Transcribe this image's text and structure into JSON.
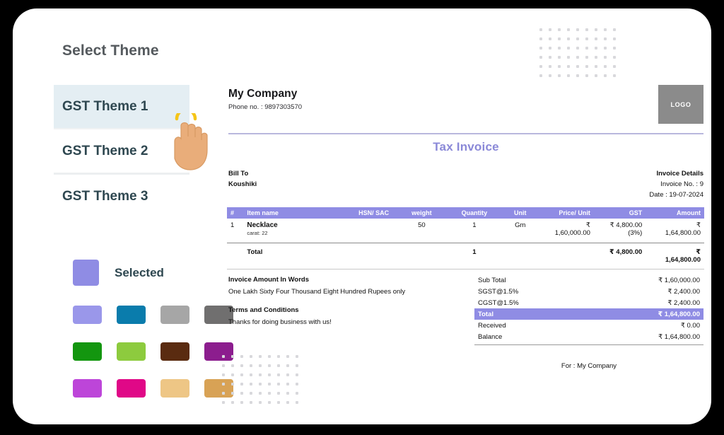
{
  "left_panel": {
    "title": "Select Theme",
    "themes": [
      {
        "label": "GST Theme 1",
        "selected": true
      },
      {
        "label": "GST Theme 2",
        "selected": false
      },
      {
        "label": "GST Theme 3",
        "selected": false
      }
    ],
    "selected_legend": {
      "label": "Selected",
      "color": "#8f8ce4"
    },
    "palette": [
      "#9a97ea",
      "#0a7cac",
      "#a6a6a6",
      "#706f6f",
      "#13960f",
      "#8dcb3e",
      "#5a2b10",
      "#8c1d8e",
      "#bd45d9",
      "#e00887",
      "#eec685",
      "#d9a css"
    ],
    "palette_colors": [
      "#9a97ea",
      "#0a7cac",
      "#a6a6a6",
      "#706f6f",
      "#13960f",
      "#8dcb3e",
      "#5a2b10",
      "#8c1d8e",
      "#bd45d9",
      "#e00887",
      "#eec685",
      "#d8a255"
    ]
  },
  "invoice": {
    "company_name": "My Company",
    "phone": "Phone no. : 9897303570",
    "logo_label": "LOGO",
    "title": "Tax Invoice",
    "accent_color": "#8f8ce4",
    "bill_to_label": "Bill To",
    "bill_to_name": "Koushiki",
    "invoice_details_label": "Invoice Details",
    "invoice_no": "Invoice No. : 9",
    "date": "Date : 19-07-2024",
    "table": {
      "headers": [
        "#",
        "Item name",
        "HSN/ SAC",
        "weight",
        "Quantity",
        "Unit",
        "Price/ Unit",
        "GST",
        "Amount"
      ],
      "rows": [
        {
          "index": "1",
          "item_name": "Necklace",
          "item_sub": "carat: 22",
          "hsn_sac": "",
          "weight": "50",
          "quantity": "1",
          "unit": "Gm",
          "price_unit_symbol": "₹",
          "price_unit": "1,60,000.00",
          "gst": "₹ 4,800.00",
          "gst_pct": "(3%)",
          "amount_symbol": "₹",
          "amount": "1,64,800.00"
        }
      ],
      "total_row": {
        "label": "Total",
        "quantity": "1",
        "gst": "₹ 4,800.00",
        "amount_symbol": "₹",
        "amount": "1,64,800.00"
      }
    },
    "amount_in_words_label": "Invoice Amount In Words",
    "amount_in_words": "One Lakh Sixty Four Thousand Eight Hundred Rupees only",
    "terms_label": "Terms and Conditions",
    "terms_text": "Thanks for doing business with us!",
    "summary": [
      {
        "label": "Sub Total",
        "value": "₹ 1,60,000.00",
        "highlight": false
      },
      {
        "label": "SGST@1.5%",
        "value": "₹ 2,400.00",
        "highlight": false
      },
      {
        "label": "CGST@1.5%",
        "value": "₹ 2,400.00",
        "highlight": false
      },
      {
        "label": "Total",
        "value": "₹ 1,64,800.00",
        "highlight": true
      },
      {
        "label": "Received",
        "value": "₹ 0.00",
        "highlight": false
      },
      {
        "label": "Balance",
        "value": "₹ 1,64,800.00",
        "highlight": false
      }
    ],
    "for_line": "For : My Company"
  }
}
